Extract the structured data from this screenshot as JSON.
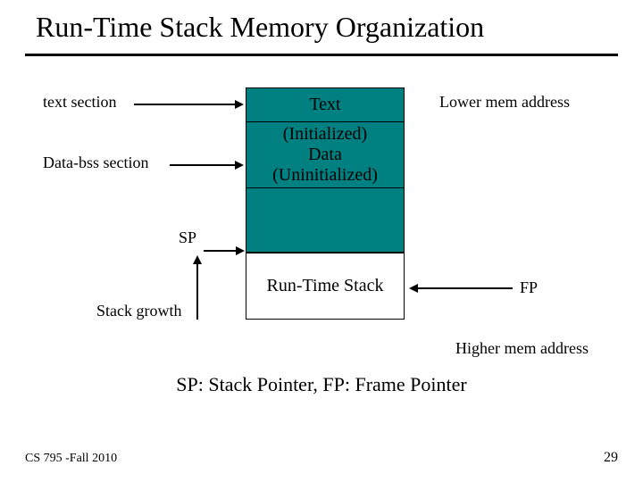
{
  "title": "Run-Time Stack Memory Organization",
  "labels": {
    "text_section": "text section",
    "data_bss": "Data-bss section",
    "low_mem": "Lower mem address",
    "hi_mem": "Higher mem address",
    "sp": "SP",
    "fp": "FP",
    "stack_growth": "Stack growth"
  },
  "boxes": {
    "text": "Text",
    "data_line1": "(Initialized)",
    "data_line2": "Data",
    "data_line3": "(Uninitialized)",
    "stack": "Run-Time Stack"
  },
  "caption": "SP: Stack Pointer, FP: Frame Pointer",
  "footer": {
    "course": "CS 795 -Fall 2010",
    "page": "29"
  },
  "diagram": {
    "description": "Vertical memory layout. From lower address downward: Text segment, Data segment (initialized then uninitialized / bss), a gap where the heap would grow, then the Run-Time Stack at higher addresses. SP points at the top of the stack (the gap/stack boundary). FP points into the Run-Time Stack frame. An upward arrow labeled Stack growth indicates the stack grows toward lower addresses.",
    "segments_top_to_bottom": [
      "Text",
      "Data (Initialized / Uninitialized)",
      "gap",
      "Run-Time Stack"
    ],
    "pointers": {
      "SP": "top of Run-Time Stack",
      "FP": "inside current stack frame"
    },
    "stack_grows": "toward lower addresses (up in the figure)"
  }
}
